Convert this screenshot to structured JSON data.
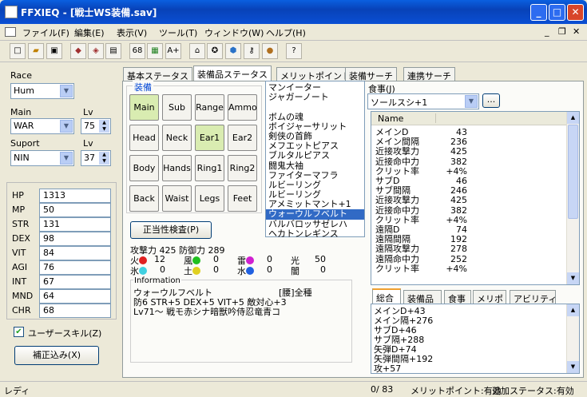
{
  "window": {
    "title": "FFXIEQ - [戦士WS装備.sav]"
  },
  "menu": [
    "ファイル(F)",
    "編集(E)",
    "表示(V)",
    "ツール(T)",
    "ウィンドウ(W)",
    "ヘルプ(H)"
  ],
  "toolbar": {
    "icon_labels": [
      "68",
      "A+"
    ]
  },
  "char": {
    "race_label": "Race",
    "race": "Hum",
    "main_label": "Main",
    "main": "WAR",
    "main_lv_label": "Lv",
    "main_lv": "75",
    "support_label": "Suport",
    "support": "NIN",
    "support_lv_label": "Lv",
    "support_lv": "37"
  },
  "stats": [
    {
      "name": "HP",
      "value": "1313"
    },
    {
      "name": "MP",
      "value": "50"
    },
    {
      "name": "STR",
      "value": "131"
    },
    {
      "name": "DEX",
      "value": "98"
    },
    {
      "name": "VIT",
      "value": "84"
    },
    {
      "name": "AGI",
      "value": "76"
    },
    {
      "name": "INT",
      "value": "67"
    },
    {
      "name": "MND",
      "value": "64"
    },
    {
      "name": "CHR",
      "value": "68"
    }
  ],
  "user_skill": "ユーザースキル(Z)",
  "correct_btn": "補正込み(X)",
  "tabs": [
    "基本ステータス",
    "装備品ステータス",
    "メリットポイント",
    "装備サーチ",
    "連携サーチ"
  ],
  "equip": {
    "group_label": "装備",
    "slots": [
      "Main",
      "Sub",
      "Range",
      "Ammo",
      "Head",
      "Neck",
      "Ear1",
      "Ear2",
      "Body",
      "Hands",
      "Ring1",
      "Ring2",
      "Back",
      "Waist",
      "Legs",
      "Feet"
    ],
    "validate_btn": "正当性検査(P)",
    "atk_def": "攻撃力 425 防御力 289",
    "elements": [
      {
        "name": "火",
        "value": "12",
        "color": "#e02020"
      },
      {
        "name": "風",
        "value": "0",
        "color": "#20c020"
      },
      {
        "name": "雷",
        "value": "0",
        "color": "#d020d0"
      },
      {
        "name": "光",
        "value": "50",
        "color": ""
      },
      {
        "name": "氷",
        "value": "0",
        "color": "#40d0e0"
      },
      {
        "name": "土",
        "value": "0",
        "color": "#e0d020"
      },
      {
        "name": "水",
        "value": "0",
        "color": "#2060e0"
      },
      {
        "name": "闇",
        "value": "0",
        "color": ""
      }
    ],
    "info_label": "Information",
    "info_name": "ウォーウルフベルト",
    "info_tag": "[腰]全種",
    "info_line1": "防6 STR+5 DEX+5 VIT+5 敵対心+3",
    "info_line2": "Lv71～ 戦モ赤シナ暗獣吟侍忍竜青コ"
  },
  "items": [
    "マンイーター",
    "ジャガーノート",
    "",
    "ボムの魂",
    "ボイジャーサリット",
    "剣侠の首飾",
    "メフエットピアス",
    "ブルタルピアス",
    "闘鬼大袖",
    "ファイターマフラ",
    "ルビーリング",
    "ルビーリング",
    "アメミットマント+1",
    "ウォーウルフベルト",
    "バルバロッサゼレハ",
    "ヘカトンレギンス"
  ],
  "food": {
    "label": "食事(J)",
    "selected": "ソールスシ+1",
    "more": "..."
  },
  "param_header": "Name",
  "params": [
    {
      "n": "メインD",
      "v": "43"
    },
    {
      "n": "メイン間隔",
      "v": "236"
    },
    {
      "n": "近接攻撃力",
      "v": "425"
    },
    {
      "n": "近接命中力",
      "v": "382"
    },
    {
      "n": "クリット率",
      "v": "+4%"
    },
    {
      "n": "サブD",
      "v": "46"
    },
    {
      "n": "サブ間隔",
      "v": "246"
    },
    {
      "n": "近接攻撃力",
      "v": "425"
    },
    {
      "n": "近接命中力",
      "v": "382"
    },
    {
      "n": "クリット率",
      "v": "+4%"
    },
    {
      "n": "遠隔D",
      "v": "74"
    },
    {
      "n": "遠隔間隔",
      "v": "192"
    },
    {
      "n": "遠隔攻撃力",
      "v": "278"
    },
    {
      "n": "遠隔命中力",
      "v": "252"
    },
    {
      "n": "クリット率",
      "v": "+4%"
    }
  ],
  "sub_tabs": [
    "総合",
    "装備品",
    "食事",
    "メリポ",
    "アビリティ"
  ],
  "summary": [
    "メインD+43",
    "メイン隔+276",
    "サブD+46",
    "サブ隔+288",
    "矢弾D+74",
    "矢弾間隔+192",
    "攻+57"
  ],
  "status": {
    "left": "レディ",
    "count": "0/  83",
    "merit": "メリットポイント:有効",
    "extra": "追加ステータス:有効"
  }
}
